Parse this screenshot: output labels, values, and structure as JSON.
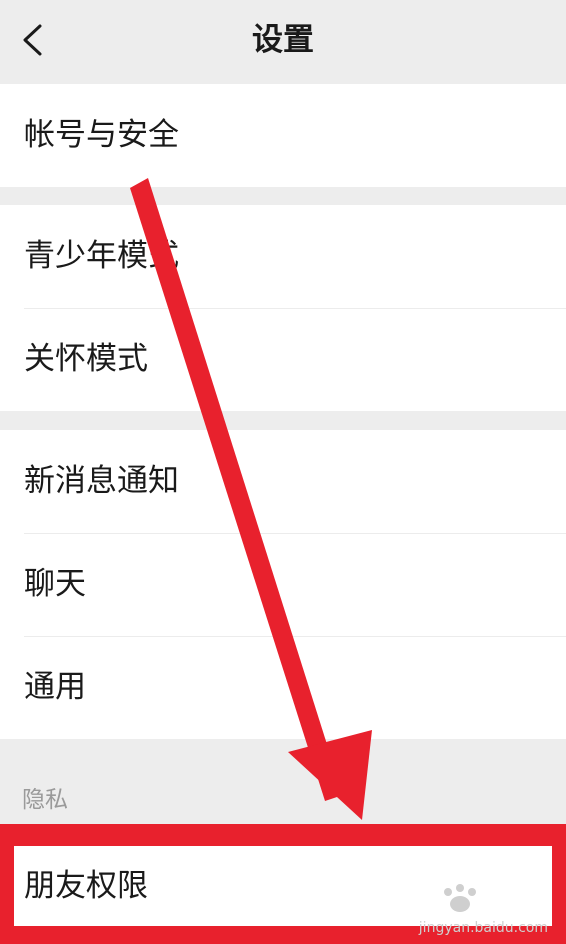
{
  "header": {
    "title": "设置"
  },
  "groups": [
    {
      "items": [
        {
          "label": "帐号与安全"
        }
      ]
    },
    {
      "items": [
        {
          "label": "青少年模式"
        },
        {
          "label": "关怀模式"
        }
      ]
    },
    {
      "items": [
        {
          "label": "新消息通知"
        },
        {
          "label": "聊天"
        },
        {
          "label": "通用"
        }
      ]
    }
  ],
  "privacy": {
    "section_label": "隐私",
    "friend_permissions": "朋友权限"
  },
  "watermark": {
    "text": "jingyan.baidu.com"
  },
  "colors": {
    "background": "#ededed",
    "highlight": "#e8212d",
    "arrow": "#e8212d"
  }
}
